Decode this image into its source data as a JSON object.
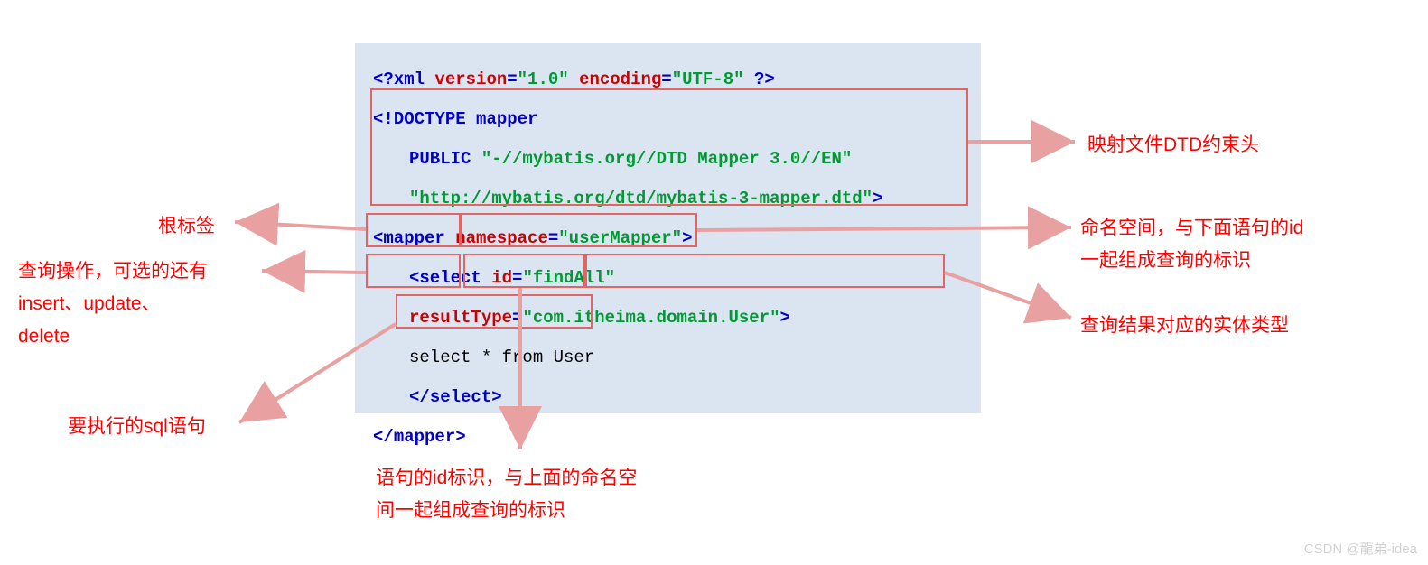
{
  "code": {
    "line1_a": "<?",
    "line1_b": "xml",
    "line1_c": " version",
    "line1_d": "=",
    "line1_e": "\"1.0\"",
    "line1_f": " encoding",
    "line1_g": "=",
    "line1_h": "\"UTF-8\"",
    "line1_i": " ?>",
    "line2_a": "<!",
    "line2_b": "DOCTYPE",
    "line2_c": " mapper",
    "line3_a": "PUBLIC",
    "line3_b": " \"-//mybatis.org//DTD Mapper 3.0//EN\"",
    "line4_a": "\"http://mybatis.org/dtd/mybatis-3-mapper.dtd\"",
    "line4_b": ">",
    "line5_a": "<",
    "line5_b": "mapper",
    "line5_c": " namespace",
    "line5_d": "=",
    "line5_e": "\"userMapper\"",
    "line5_f": ">",
    "line6_a": "<",
    "line6_b": "select",
    "line6_c": " id",
    "line6_d": "=",
    "line6_e": "\"findAll\"",
    "line6_f": " resultType",
    "line6_g": "=",
    "line6_h": "\"com.itheima.domain.User\"",
    "line6_i": ">",
    "line7": "select  * from User",
    "line8_a": "</",
    "line8_b": "select",
    "line8_c": ">",
    "line9_a": "</",
    "line9_b": "mapper",
    "line9_c": ">"
  },
  "annotations": {
    "root_tag": "根标签",
    "query_op_l1": "查询操作，可选的还有",
    "query_op_l2": "insert、update、",
    "query_op_l3": "delete",
    "sql_stmt": "要执行的sql语句",
    "stmt_id_l1": "语句的id标识，与上面的命名空",
    "stmt_id_l2": "间一起组成查询的标识",
    "dtd": "映射文件DTD约束头",
    "ns_l1": "命名空间，与下面语句的id",
    "ns_l2": "一起组成查询的标识",
    "result_type": "查询结果对应的实体类型"
  },
  "watermark": "CSDN @龍弟-idea"
}
